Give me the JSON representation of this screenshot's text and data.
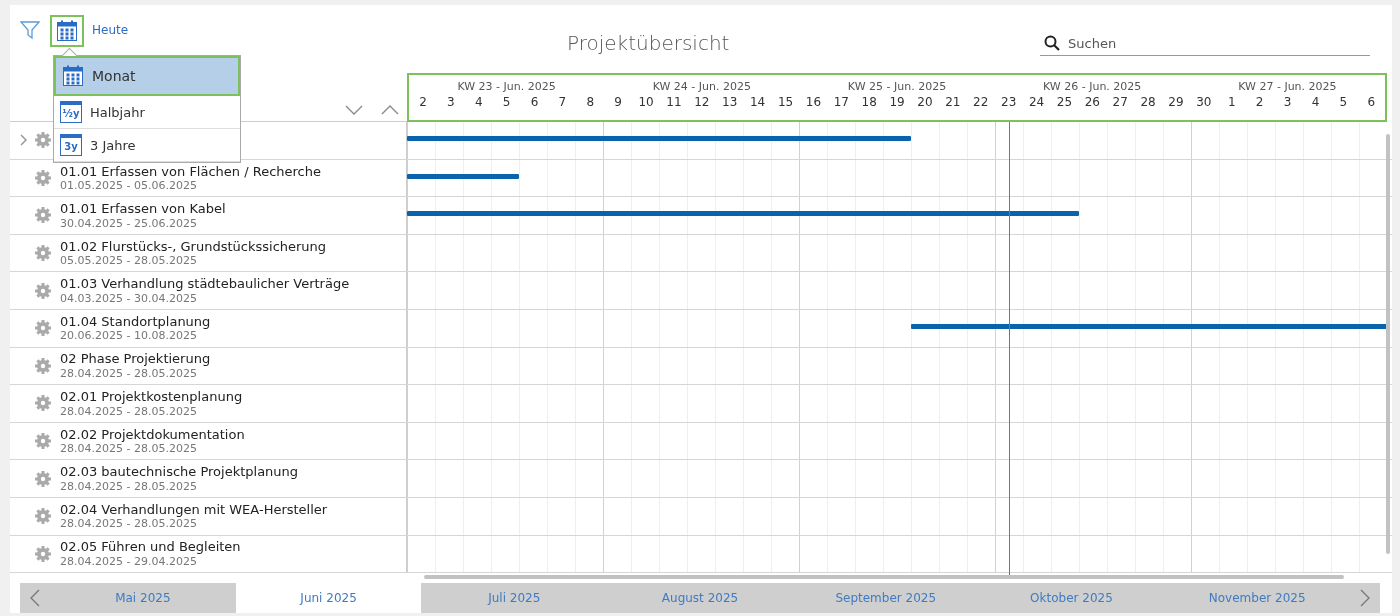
{
  "toolbar": {
    "today_button": "Heute",
    "title": "Projektübersicht",
    "search": {
      "placeholder": "Suchen"
    }
  },
  "view_menu": {
    "open": true,
    "items": [
      {
        "label": "Monat",
        "selected": true
      },
      {
        "label": "Halbjahr",
        "icon_text": "½y",
        "selected": false
      },
      {
        "label": "3 Jahre",
        "icon_text": "3y",
        "selected": false
      }
    ]
  },
  "timeline": {
    "today_marker": {
      "level": 0.614
    },
    "weeks": [
      "KW 23 - Jun. 2025",
      "KW 24 - Jun. 2025",
      "KW 25 - Jun. 2025",
      "KW 26 - Jun. 2025",
      "KW 27 - Jun. 2025"
    ],
    "days": [
      "2",
      "3",
      "4",
      "5",
      "6",
      "7",
      "8",
      "9",
      "10",
      "11",
      "12",
      "13",
      "14",
      "15",
      "16",
      "17",
      "18",
      "19",
      "20",
      "21",
      "22",
      "23",
      "24",
      "25",
      "26",
      "27",
      "28",
      "29",
      "30",
      "1",
      "2",
      "3",
      "4",
      "5",
      "6"
    ]
  },
  "tasks": [
    {
      "kind": "group",
      "expanded": false,
      "bar": {
        "kind": "until",
        "level": 0.514
      }
    },
    {
      "kind": "task",
      "title": "01.01 Erfassen von Flächen / Recherche",
      "dates": "01.05.2025 - 05.06.2025",
      "bar": {
        "kind": "until",
        "level": 0.114
      }
    },
    {
      "kind": "task",
      "title": "01.01 Erfassen von Kabel",
      "dates": "30.04.2025 - 25.06.2025",
      "bar": {
        "kind": "until",
        "level": 0.686
      }
    },
    {
      "kind": "task",
      "title": "01.02 Flurstücks-, Grundstückssicherung",
      "dates": "05.05.2025 - 28.05.2025"
    },
    {
      "kind": "task",
      "title": "01.03 Verhandlung städtebaulicher Verträge",
      "dates": "04.03.2025 - 30.04.2025"
    },
    {
      "kind": "task",
      "title": "01.04 Standortplanung",
      "dates": "20.06.2025 - 10.08.2025",
      "bar": {
        "kind": "from",
        "level": 0.514
      }
    },
    {
      "kind": "task",
      "title": "02 Phase Projektierung",
      "dates": "28.04.2025 - 28.05.2025"
    },
    {
      "kind": "task",
      "title": "02.01 Projektkostenplanung",
      "dates": "28.04.2025 - 28.05.2025"
    },
    {
      "kind": "task",
      "title": "02.02 Projektdokumentation",
      "dates": "28.04.2025 - 28.05.2025"
    },
    {
      "kind": "task",
      "title": "02.03 bautechnische Projektplanung",
      "dates": "28.04.2025 - 28.05.2025"
    },
    {
      "kind": "task",
      "title": "02.04 Verhandlungen mit WEA-Hersteller",
      "dates": "28.04.2025 - 28.05.2025"
    },
    {
      "kind": "task",
      "title": "02.05 Führen und Begleiten",
      "dates": "28.04.2025 - 29.04.2025"
    }
  ],
  "months": [
    {
      "label": "Mai 2025",
      "selected": false
    },
    {
      "label": "Juni 2025",
      "selected": true
    },
    {
      "label": "Juli 2025",
      "selected": false
    },
    {
      "label": "August 2025",
      "selected": false
    },
    {
      "label": "September 2025",
      "selected": false
    },
    {
      "label": "Oktober 2025",
      "selected": false
    },
    {
      "label": "November 2025",
      "selected": false
    }
  ]
}
